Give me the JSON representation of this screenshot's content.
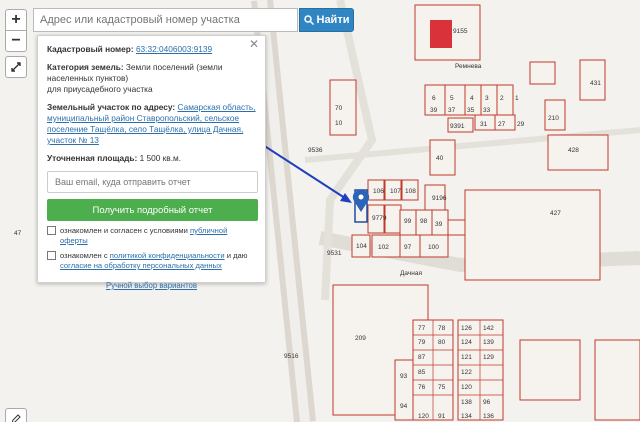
{
  "search": {
    "placeholder": "Адрес или кадастровый номер участка",
    "button_label": "Найти"
  },
  "controls": {
    "zoom_in": "+",
    "zoom_out": "−"
  },
  "panel": {
    "cadastral_label": "Кадастровый номер:",
    "cadastral_value": "63:32:0406003:9139",
    "category_label": "Категория земель:",
    "category_value": "Земли поселений (земли населенных пунктов)",
    "use_value": "для приусадебного участка",
    "address_label": "Земельный участок по адресу:",
    "address_value": "Самарская область, муниципальный район Ставропольский, сельское поселение Тащёлка, село Тащёлка, улица Дачная, участок № 13",
    "area_label": "Уточненная площадь:",
    "area_value": "1 500 кв.м.",
    "email_placeholder": "Ваш email, куда отправить отчет",
    "report_button": "Получить подробный отчет",
    "consent1_text": "ознакомлен и согласен с условиями",
    "consent1_link": "публичной оферты",
    "consent2_text": "ознакомлен с",
    "consent2_link1": "политикой конфиденциальности",
    "consent2_mid": "и даю",
    "consent2_link2": "согласие на обработку персональных данных",
    "manual_link": "Ручной выбор вариантов"
  },
  "map_labels": {
    "parcels": [
      "9155",
      "Ремнева",
      "9391",
      "6",
      "5",
      "4",
      "3",
      "2",
      "1",
      "39",
      "37",
      "35",
      "33",
      "31",
      "27",
      "29",
      "10",
      "70",
      "40",
      "210",
      "431",
      "428",
      "427",
      "9536",
      "106",
      "107",
      "108",
      "9196",
      "9779",
      "99",
      "98",
      "39",
      "104",
      "102",
      "97",
      "100",
      "9531",
      "Дачная",
      "209",
      "47",
      "9516",
      "77",
      "78",
      "79",
      "80",
      "126",
      "142",
      "124",
      "139",
      "87",
      "121",
      "129",
      "122",
      "85",
      "76",
      "75",
      "120",
      "93",
      "138",
      "94",
      "96",
      "136",
      "134",
      "120",
      "91"
    ],
    "selected_parcel": "13"
  },
  "colors": {
    "accent": "#2f86c3",
    "report_green": "#4cae4c",
    "parcel_line": "#c0392b",
    "link": "#2b6fad",
    "pin": "#2a63b8"
  }
}
